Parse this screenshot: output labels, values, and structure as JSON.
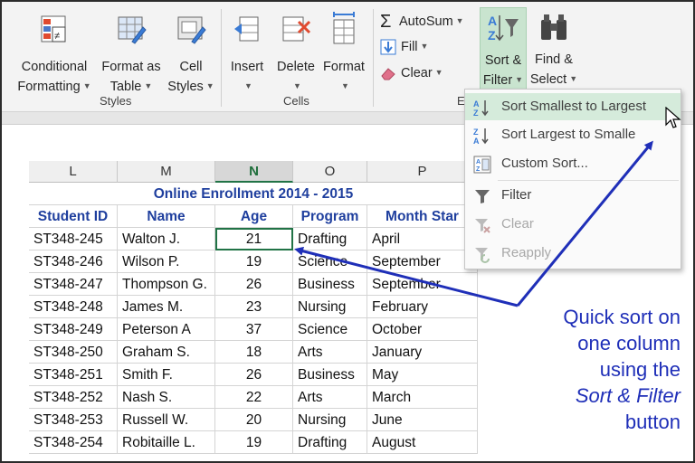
{
  "ribbon": {
    "conditional_formatting": {
      "line1": "Conditional",
      "line2": "Formatting"
    },
    "format_as_table": {
      "line1": "Format as",
      "line2": "Table"
    },
    "cell_styles": {
      "line1": "Cell",
      "line2": "Styles"
    },
    "insert": "Insert",
    "delete": "Delete",
    "format": "Format",
    "autosum": "AutoSum",
    "fill": "Fill",
    "clear": "Clear",
    "sort_filter": {
      "line1": "Sort &",
      "line2": "Filter"
    },
    "find_select": {
      "line1": "Find &",
      "line2": "Select"
    },
    "groups": {
      "styles": "Styles",
      "cells": "Cells",
      "editing_partial": "E"
    }
  },
  "columns": [
    {
      "letter": "L",
      "selected": false
    },
    {
      "letter": "M",
      "selected": false
    },
    {
      "letter": "N",
      "selected": true
    },
    {
      "letter": "O",
      "selected": false
    },
    {
      "letter": "P",
      "selected": false
    }
  ],
  "sheet": {
    "title": "Online Enrollment 2014 - 2015",
    "headers": [
      "Student ID",
      "Name",
      "Age",
      "Program",
      "Month Star"
    ],
    "rows": [
      [
        "ST348-245",
        "Walton J.",
        "21",
        "Drafting",
        "April"
      ],
      [
        "ST348-246",
        "Wilson P.",
        "19",
        "Science",
        "September"
      ],
      [
        "ST348-247",
        "Thompson G.",
        "26",
        "Business",
        "September"
      ],
      [
        "ST348-248",
        "James M.",
        "23",
        "Nursing",
        "February"
      ],
      [
        "ST348-249",
        "Peterson A",
        "37",
        "Science",
        "October"
      ],
      [
        "ST348-250",
        "Graham S.",
        "18",
        "Arts",
        "January"
      ],
      [
        "ST348-251",
        "Smith F.",
        "26",
        "Business",
        "May"
      ],
      [
        "ST348-252",
        "Nash S.",
        "22",
        "Arts",
        "March"
      ],
      [
        "ST348-253",
        "Russell W.",
        "20",
        "Nursing",
        "June"
      ],
      [
        "ST348-254",
        "Robitaille L.",
        "19",
        "Drafting",
        "August"
      ]
    ]
  },
  "menu": {
    "items": [
      {
        "label": "Sort Smallest to Largest",
        "icon": "sort-ascending-icon",
        "highlighted": true,
        "disabled": false
      },
      {
        "label": "Sort Largest to Smalle",
        "icon": "sort-descending-icon",
        "highlighted": false,
        "disabled": false
      },
      {
        "label": "Custom Sort...",
        "icon": "custom-sort-icon",
        "highlighted": false,
        "disabled": false
      },
      {
        "label": "Filter",
        "icon": "filter-icon",
        "highlighted": false,
        "disabled": false
      },
      {
        "label": "Clear",
        "icon": "clear-filter-icon",
        "highlighted": false,
        "disabled": true
      },
      {
        "label": "Reapply",
        "icon": "reapply-icon",
        "highlighted": false,
        "disabled": true
      }
    ]
  },
  "annotation": {
    "line1": "Quick sort on",
    "line2": "one column",
    "line3": "using the",
    "line4": "Sort & Filter",
    "line5": "button"
  },
  "colors": {
    "accent_green": "#217346",
    "header_blue": "#1f3f9e",
    "annotation_blue": "#1f2fb8",
    "menu_highlight": "#d5ebdb"
  }
}
